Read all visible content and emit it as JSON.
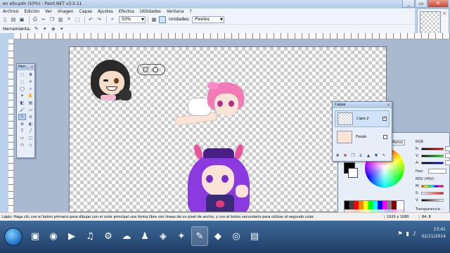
{
  "window": {
    "title": "en ello.pdn (50%) - Paint.NET v3.5.11"
  },
  "menu": [
    "Archivo",
    "Edición",
    "Ver",
    "Imagen",
    "Capas",
    "Ajustes",
    "Efectos",
    "Utilidades",
    "Ventana",
    "?"
  ],
  "toolbar": {
    "zoom_value": "50%",
    "units_label": "Unidades:",
    "units_value": "Píxeles",
    "tool_label": "Herramienta:"
  },
  "tools_panel": {
    "title": "Herr..."
  },
  "layers_panel": {
    "title": "Capas",
    "layers": [
      {
        "name": "Capa 2",
        "visible": true
      },
      {
        "name": "Fondo",
        "visible": false
      }
    ]
  },
  "colors_panel": {
    "less_button": "Menos",
    "rgb_label": "RGB",
    "r": "R:",
    "g": "V:",
    "b": "A:",
    "hex_label": "Hex:",
    "hsv_label": "MSV (HSV)",
    "h": "M:",
    "s": "S:",
    "v": "V:",
    "transparency_label": "Transparencia - canal"
  },
  "status": {
    "message": "Lápiz: Haga clic con el botón primario para dibujar con el color principal una forma libre con líneas de un píxel de ancho, y con el botón secundario para utilizar el segundo color.",
    "size": "1920 x 1080",
    "coords": "84, 8"
  },
  "taskbar": {
    "time": "13:41",
    "date": "02/11/2014"
  },
  "colors": {
    "accent": "#b9d1ea",
    "close": "#c7452f"
  }
}
